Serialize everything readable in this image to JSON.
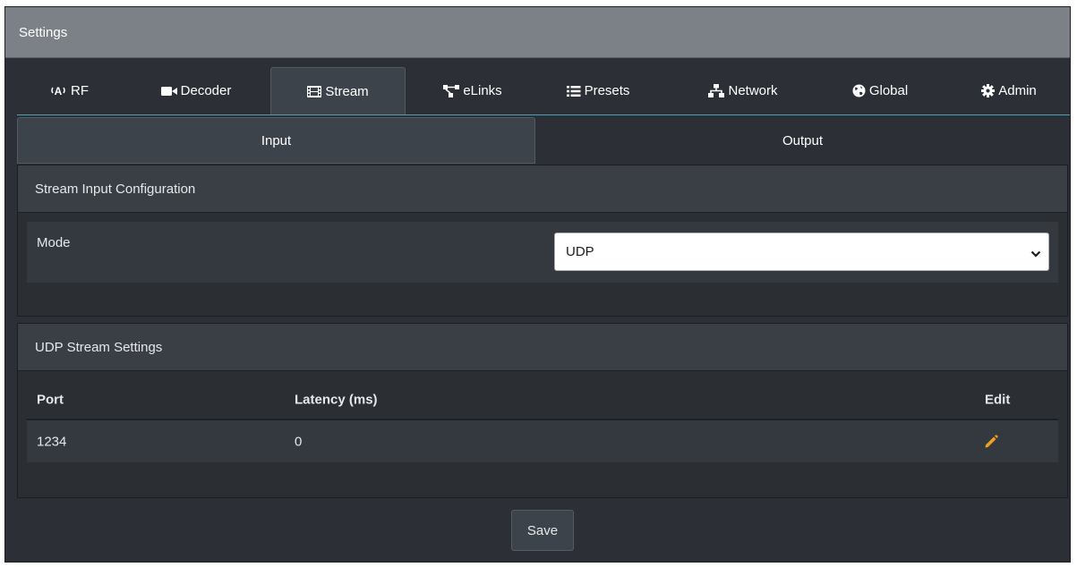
{
  "window": {
    "title": "Settings"
  },
  "tabs": [
    {
      "label": "RF",
      "icon": "antenna-icon"
    },
    {
      "label": "Decoder",
      "icon": "video-camera-icon"
    },
    {
      "label": "Stream",
      "icon": "film-icon",
      "active": true
    },
    {
      "label": "eLinks",
      "icon": "network-topology-icon"
    },
    {
      "label": "Presets",
      "icon": "list-icon"
    },
    {
      "label": "Network",
      "icon": "sitemap-icon"
    },
    {
      "label": "Global",
      "icon": "globe-icon"
    },
    {
      "label": "Admin",
      "icon": "gear-icon"
    }
  ],
  "subtabs": [
    {
      "label": "Input",
      "active": true
    },
    {
      "label": "Output",
      "active": false
    }
  ],
  "input_config": {
    "title": "Stream Input Configuration",
    "mode_label": "Mode",
    "mode_value": "UDP"
  },
  "udp_settings": {
    "title": "UDP Stream Settings",
    "columns": [
      "Port",
      "Latency (ms)",
      "Edit"
    ],
    "rows": [
      {
        "port": "1234",
        "latency": "0",
        "edit_icon": "pencil-icon"
      }
    ]
  },
  "actions": {
    "save_label": "Save"
  },
  "colors": {
    "accent": "#48a3b5",
    "edit_icon": "#f0a023",
    "title_bar": "#7c8187",
    "background": "#2c3036"
  }
}
